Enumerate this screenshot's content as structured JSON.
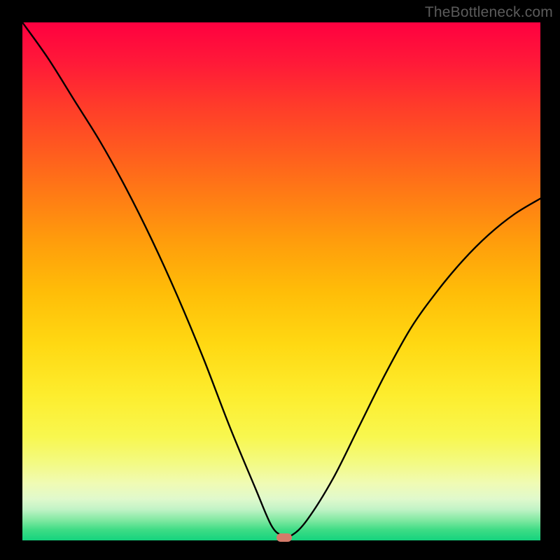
{
  "watermark": "TheBottleneck.com",
  "chart_data": {
    "type": "line",
    "title": "",
    "xlabel": "",
    "ylabel": "",
    "xlim": [
      0,
      100
    ],
    "ylim": [
      0,
      100
    ],
    "series": [
      {
        "name": "bottleneck-curve",
        "x": [
          0,
          5,
          10,
          15,
          20,
          25,
          30,
          35,
          40,
          45,
          48,
          50,
          52,
          55,
          60,
          65,
          70,
          75,
          80,
          85,
          90,
          95,
          100
        ],
        "y": [
          100,
          93,
          85,
          77,
          68,
          58,
          47,
          35,
          22,
          10,
          3,
          1,
          1,
          4,
          12,
          22,
          32,
          41,
          48,
          54,
          59,
          63,
          66
        ]
      }
    ],
    "marker": {
      "x": 50.5,
      "y": 0.5
    },
    "background_gradient": {
      "top": "#ff0040",
      "mid": "#ffd812",
      "bottom": "#14d37e"
    }
  }
}
